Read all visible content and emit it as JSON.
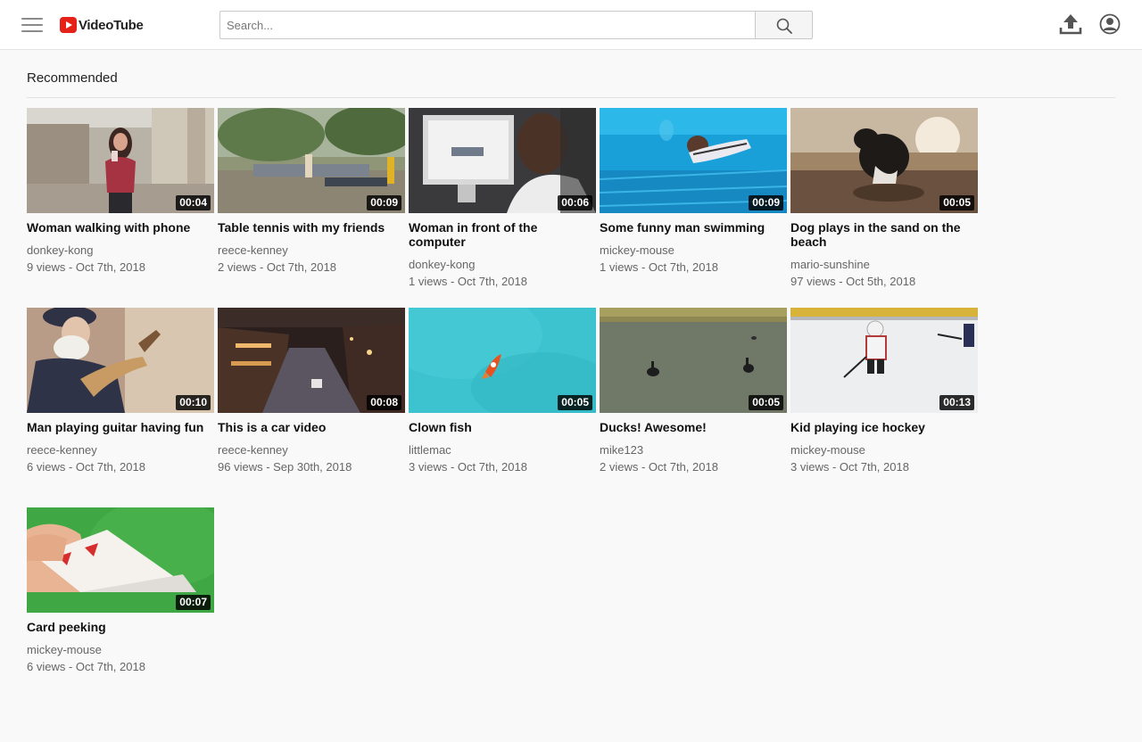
{
  "app": {
    "name": "VideoTube"
  },
  "search": {
    "placeholder": "Search..."
  },
  "section": {
    "title": "Recommended"
  },
  "videos": [
    {
      "title": "Woman walking with phone",
      "channel": "donkey-kong",
      "meta": "9 views - Oct 7th, 2018",
      "duration": "00:04"
    },
    {
      "title": "Table tennis with my friends",
      "channel": "reece-kenney",
      "meta": "2 views - Oct 7th, 2018",
      "duration": "00:09"
    },
    {
      "title": "Woman in front of the computer",
      "channel": "donkey-kong",
      "meta": "1 views - Oct 7th, 2018",
      "duration": "00:06"
    },
    {
      "title": "Some funny man swimming",
      "channel": "mickey-mouse",
      "meta": "1 views - Oct 7th, 2018",
      "duration": "00:09"
    },
    {
      "title": "Dog plays in the sand on the beach",
      "channel": "mario-sunshine",
      "meta": "97 views - Oct 5th, 2018",
      "duration": "00:05"
    },
    {
      "title": "Man playing guitar having fun",
      "channel": "reece-kenney",
      "meta": "6 views - Oct 7th, 2018",
      "duration": "00:10"
    },
    {
      "title": "This is a car video",
      "channel": "reece-kenney",
      "meta": "96 views - Sep 30th, 2018",
      "duration": "00:08"
    },
    {
      "title": "Clown fish",
      "channel": "littlemac",
      "meta": "3 views - Oct 7th, 2018",
      "duration": "00:05"
    },
    {
      "title": "Ducks! Awesome!",
      "channel": "mike123",
      "meta": "2 views - Oct 7th, 2018",
      "duration": "00:05"
    },
    {
      "title": "Kid playing ice hockey",
      "channel": "mickey-mouse",
      "meta": "3 views - Oct 7th, 2018",
      "duration": "00:13"
    },
    {
      "title": "Card peeking",
      "channel": "mickey-mouse",
      "meta": "6 views - Oct 7th, 2018",
      "duration": "00:07"
    }
  ]
}
